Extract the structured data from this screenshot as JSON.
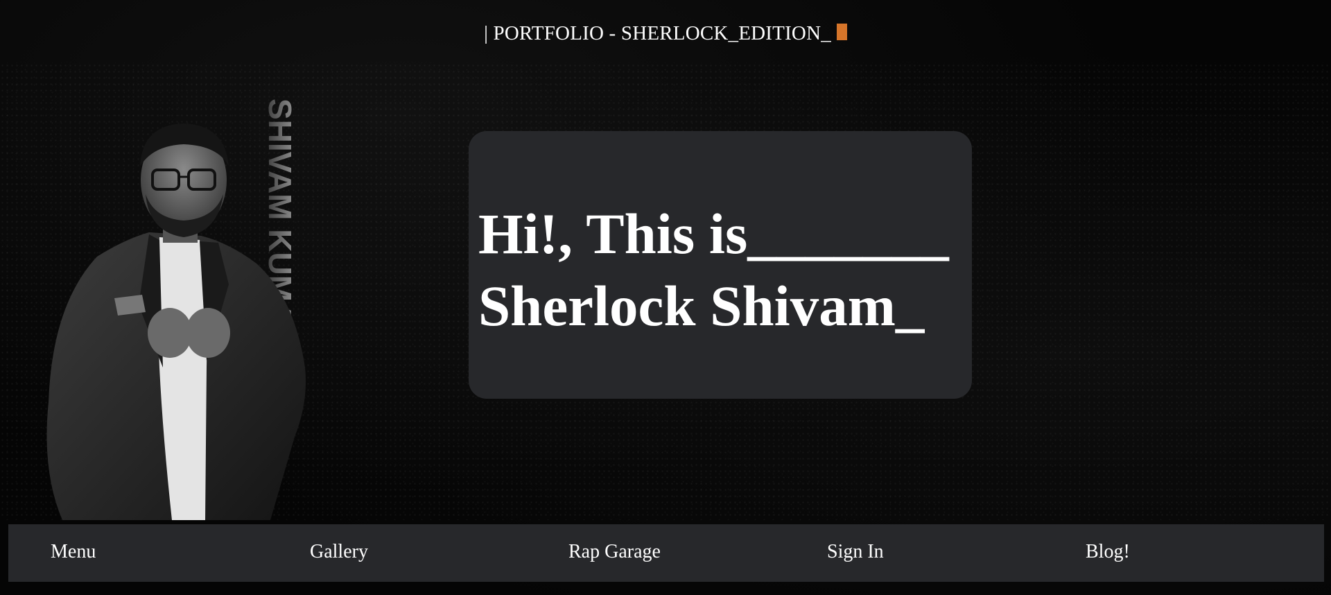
{
  "header": {
    "title": "| PORTFOLIO - SHERLOCK_EDITION_",
    "cursor_color": "#d6752a"
  },
  "portrait": {
    "side_text": "SHIVAM KUMA"
  },
  "hero": {
    "line1": "Hi!, This is_______",
    "line2": "Sherlock Shivam_"
  },
  "nav": {
    "items": [
      {
        "label": "Menu"
      },
      {
        "label": "Gallery"
      },
      {
        "label": "Rap Garage"
      },
      {
        "label": "Sign In"
      },
      {
        "label": "Blog!"
      }
    ]
  },
  "colors": {
    "background": "#050505",
    "card": "#27282b",
    "text": "#ffffff"
  }
}
